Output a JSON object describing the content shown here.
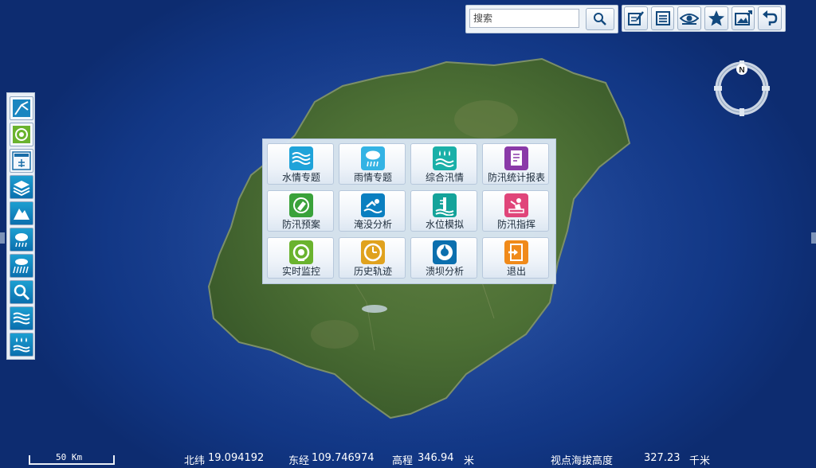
{
  "search": {
    "placeholder": "搜索",
    "button_icon": "search-icon"
  },
  "toolbar": {
    "buttons": [
      {
        "icon": "edit-icon"
      },
      {
        "icon": "list-icon"
      },
      {
        "icon": "eye-icon"
      },
      {
        "icon": "star-icon"
      },
      {
        "icon": "image-export-icon"
      },
      {
        "icon": "undo-icon"
      }
    ]
  },
  "compass": {
    "north_label": "N"
  },
  "left_tools": [
    {
      "icon": "rain-line-icon"
    },
    {
      "icon": "monitor-eye-icon"
    },
    {
      "icon": "water-station-icon"
    },
    {
      "icon": "layers-icon"
    },
    {
      "icon": "mountain-icon"
    },
    {
      "icon": "cloud-rain-icon"
    },
    {
      "icon": "rain-lines-icon"
    },
    {
      "icon": "magnifier-icon"
    },
    {
      "icon": "waves-icon"
    },
    {
      "icon": "water-drops-icon"
    }
  ],
  "menu": {
    "items": [
      {
        "label": "水情专题",
        "icon": "waves-icon",
        "color": "#1fa3d9"
      },
      {
        "label": "雨情专题",
        "icon": "cloud-rain-icon",
        "color": "#34b3e4"
      },
      {
        "label": "综合汛情",
        "icon": "water-drops-icon",
        "color": "#1ab0a8"
      },
      {
        "label": "防汛统计报表",
        "icon": "report-icon",
        "color": "#8a3aa8"
      },
      {
        "label": "防汛预案",
        "icon": "plan-icon",
        "color": "#3aa23a"
      },
      {
        "label": "淹没分析",
        "icon": "swimmer-icon",
        "color": "#0a7fc0"
      },
      {
        "label": "水位模拟",
        "icon": "water-level-icon",
        "color": "#14a39a"
      },
      {
        "label": "防汛指挥",
        "icon": "command-icon",
        "color": "#e0457a"
      },
      {
        "label": "实时监控",
        "icon": "monitor-eye-icon",
        "color": "#6ab32e"
      },
      {
        "label": "历史轨迹",
        "icon": "clock-icon",
        "color": "#e0a21e"
      },
      {
        "label": "溃坝分析",
        "icon": "dam-icon",
        "color": "#0b6fae"
      },
      {
        "label": "退出",
        "icon": "exit-icon",
        "color": "#f08a1a"
      }
    ]
  },
  "scale_bar": {
    "label": "50 Km"
  },
  "status": {
    "lat_label": "北纬",
    "lat_value": "19.094192",
    "lon_label": "东经",
    "lon_value": "109.746974",
    "elev_label": "高程",
    "elev_value": "346.94",
    "elev_unit": "米",
    "view_label": "视点海拔高度",
    "view_value": "327.23",
    "view_unit": "千米"
  }
}
